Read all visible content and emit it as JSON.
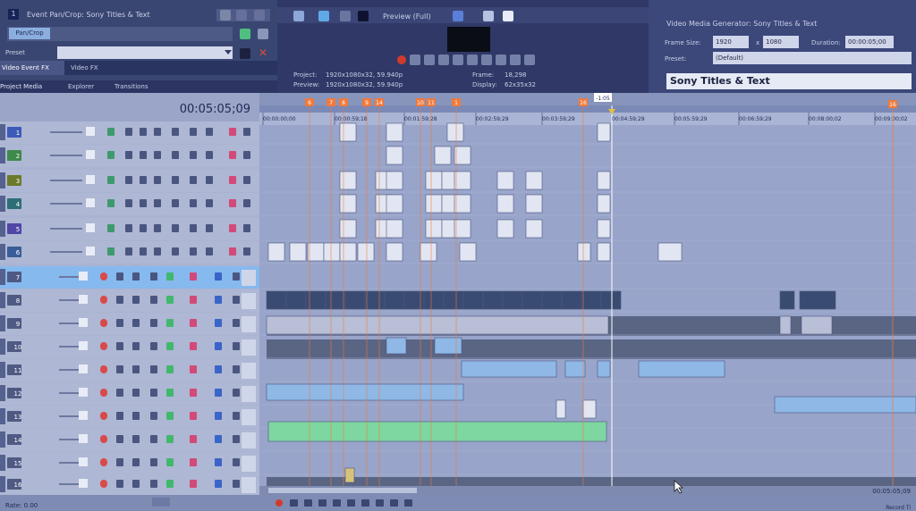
{
  "event_pan_crop": {
    "tab_number": "1",
    "title": "Event Pan/Crop: Sony Titles & Text",
    "tab_pan_crop": "Pan/Crop",
    "preset_label": "Preset",
    "tab_video_event_fx": "Video Event FX",
    "tab_video_fx": "Video FX",
    "tab_project_media": "Project Media",
    "tab_explorer": "Explorer",
    "tab_transitions": "Transitions"
  },
  "preview": {
    "mode_label": "Preview (Full)",
    "project_label": "Project:",
    "project_value": "1920x1080x32, 59.940p",
    "preview_label": "Preview:",
    "preview_value": "1920x1080x32, 59.940p",
    "frame_label": "Frame:",
    "frame_value": "18,298",
    "display_label": "Display:",
    "display_value": "62x35x32"
  },
  "media_generator": {
    "title": "Video Media Generator: Sony Titles & Text",
    "frame_size_label": "Frame Size:",
    "width": "1920",
    "x": "x",
    "height": "1080",
    "duration_label": "Duration:",
    "duration_value": "00:00:05;00",
    "preset_label": "Preset:",
    "preset_value": "(Default)",
    "plugin_name": "Sony Titles & Text"
  },
  "timeline": {
    "timecode": "00:05:05;09",
    "cursor_label": "-1:05",
    "rate_label": "Rate: 0.00",
    "bottom_timecode": "00:05:05;09",
    "record_time": "Record Ti",
    "ruler_labels": [
      "00:00:00;00",
      "00:00:59;18",
      "00:01:59;28",
      "00:02:59;29",
      "00:03:59;29",
      "00:04:59;29",
      "00:05:59;29",
      "00:06:59;29",
      "00:08:00;02",
      "00:09:00;02"
    ],
    "markers": [
      "6",
      "7",
      "8",
      "9",
      "14",
      "10",
      "11",
      "1",
      "16"
    ],
    "video_tracks": [
      "1",
      "2",
      "3",
      "4",
      "5",
      "6"
    ],
    "audio_tracks": [
      "7",
      "8",
      "9",
      "10",
      "11",
      "12",
      "13",
      "14",
      "15",
      "16"
    ]
  },
  "colors": {
    "background": "#5e6f9a",
    "panel": "#3a4672",
    "track_header": "#aeb7d3",
    "timeline_bg": "#95a1c6",
    "selected_track": "#86b9ee",
    "marker": "#f07a3c",
    "audio_clip": "#8fb8e6",
    "green_clip": "#7ed6a0",
    "dark_band": "#5a6584"
  }
}
